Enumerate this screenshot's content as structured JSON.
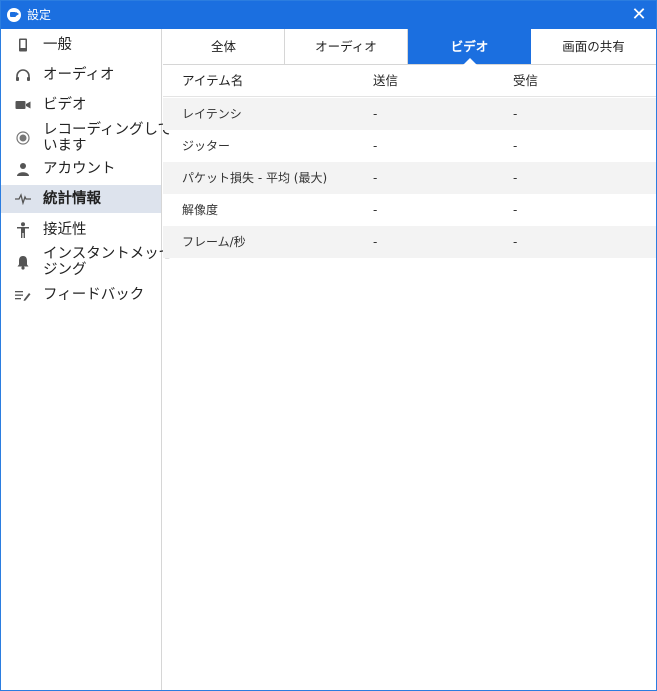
{
  "window": {
    "title": "設定",
    "close_glyph": "✕"
  },
  "sidebar": {
    "items": [
      {
        "label": "一般",
        "icon": "phone-icon"
      },
      {
        "label": "オーディオ",
        "icon": "headphones-icon"
      },
      {
        "label": "ビデオ",
        "icon": "video-camera-icon"
      },
      {
        "label": "レコーディングして\nいます",
        "icon": "record-icon"
      },
      {
        "label": "アカウント",
        "icon": "person-icon"
      },
      {
        "label": "統計情報",
        "icon": "pulse-icon",
        "active": true
      },
      {
        "label": "接近性",
        "icon": "accessibility-icon"
      },
      {
        "label": "インスタントメッセー\nジング",
        "icon": "bell-icon"
      },
      {
        "label": "フィードバック",
        "icon": "feedback-icon"
      }
    ]
  },
  "tabs": [
    {
      "label": "全体"
    },
    {
      "label": "オーディオ"
    },
    {
      "label": "ビデオ",
      "active": true
    },
    {
      "label": "画面の共有"
    }
  ],
  "table": {
    "headers": [
      "アイテム名",
      "送信",
      "受信"
    ],
    "rows": [
      [
        "レイテンシ",
        "-",
        "-"
      ],
      [
        "ジッター",
        "-",
        "-"
      ],
      [
        "パケット損失 - 平均 (最大)",
        "-",
        "-"
      ],
      [
        "解像度",
        "-",
        "-"
      ],
      [
        "フレーム/秒",
        "-",
        "-"
      ]
    ]
  },
  "colors": {
    "accent": "#1b6fe0",
    "active_nav_bg": "#dde3ed",
    "row_alt_bg": "#f3f3f3",
    "icon_gray": "#555555"
  }
}
